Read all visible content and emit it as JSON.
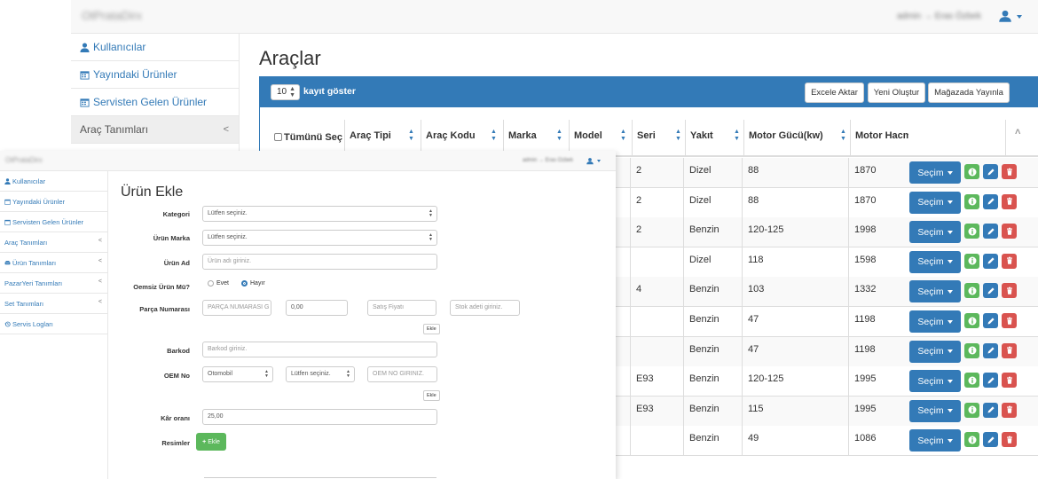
{
  "back": {
    "brand": "OtPrataDirx",
    "user_text": "admin → Eras Özbek",
    "sidebar": [
      {
        "label": "Kullanıcılar",
        "icon": "user-icon",
        "active": false
      },
      {
        "label": "Yayındaki Ürünler",
        "icon": "calendar-icon",
        "active": false
      },
      {
        "label": "Servisten Gelen Ürünler",
        "icon": "calendar-icon",
        "active": false
      },
      {
        "label": "Araç Tanımları",
        "icon": "",
        "active": true,
        "chevron": "<"
      }
    ],
    "page_title": "Araçlar",
    "length_value": "10",
    "length_label": "kayıt göster",
    "buttons": {
      "excel": "Excele Aktar",
      "new": "Yeni Oluştur",
      "publish": "Mağazada Yayınla"
    },
    "columns": [
      "Tümünü Seç",
      "Araç Tipi",
      "Araç Kodu",
      "Marka",
      "Model",
      "Seri",
      "Yakıt",
      "Motor Gücü(kw)",
      "Motor Hacm"
    ],
    "rows": [
      {
        "seri": "2",
        "yakit": "Dizel",
        "guc": "88",
        "hacim": "1870"
      },
      {
        "seri": "2",
        "yakit": "Dizel",
        "guc": "88",
        "hacim": "1870"
      },
      {
        "seri": "2",
        "yakit": "Benzin",
        "guc": "120-125",
        "hacim": "1998"
      },
      {
        "seri": "",
        "yakit": "Dizel",
        "guc": "118",
        "hacim": "1598"
      },
      {
        "seri": "4",
        "yakit": "Benzin",
        "guc": "103",
        "hacim": "1332"
      },
      {
        "seri": "",
        "yakit": "Benzin",
        "guc": "47",
        "hacim": "1198"
      },
      {
        "seri": "",
        "yakit": "Benzin",
        "guc": "47",
        "hacim": "1198"
      },
      {
        "seri": "E93",
        "yakit": "Benzin",
        "guc": "120-125",
        "hacim": "1995"
      },
      {
        "seri": "E93",
        "yakit": "Benzin",
        "guc": "115",
        "hacim": "1995"
      },
      {
        "seri": "",
        "yakit": "Benzin",
        "guc": "49",
        "hacim": "1086"
      }
    ],
    "secim_label": "Seçim"
  },
  "front": {
    "brand": "OtPrataDirx",
    "user_text": "admin → Eras Özbek",
    "sidebar": [
      {
        "label": "Kullanıcılar",
        "icon": "user-icon"
      },
      {
        "label": "Yayındaki Ürünler",
        "icon": "calendar-icon"
      },
      {
        "label": "Servisten Gelen Ürünler",
        "icon": "calendar-icon"
      },
      {
        "label": "Araç Tanımları",
        "icon": "",
        "chevron": "<"
      },
      {
        "label": "Ürün Tanımları",
        "icon": "car-icon",
        "chevron": "<"
      },
      {
        "label": "PazarYeri Tanımları",
        "icon": "",
        "chevron": "<"
      },
      {
        "label": "Set Tanımları",
        "icon": "",
        "chevron": "<"
      },
      {
        "label": "Servis Logları",
        "icon": "history-icon"
      }
    ],
    "title": "Ürün Ekle",
    "form": {
      "kategori_label": "Kategori",
      "kategori_value": "Lütfen seçiniz.",
      "marka_label": "Ürün Marka",
      "marka_value": "Lütfen seçiniz.",
      "ad_label": "Ürün Ad",
      "ad_placeholder": "Ürün adı giriniz.",
      "oem_q_label": "Oemsiz Ürün Mü?",
      "radio_yes": "Evet",
      "radio_no": "Hayır",
      "parca_label": "Parça Numarası",
      "parca_placeholder": "PARÇA NUMARASI G",
      "parca_price": "0,00",
      "satis_placeholder": "Satış Fiyatı",
      "stok_placeholder": "Stok adeti giriniz.",
      "ekle_small": "Ekle",
      "barkod_label": "Barkod",
      "barkod_placeholder": "Barkod giriniz.",
      "oem_label": "OEM No",
      "oem_type": "Otomobil",
      "oem_select": "Lütfen seçiniz.",
      "oem_placeholder": "OEM NO GIRINIZ.",
      "kar_label": "Kâr oranı",
      "kar_value": "25,00",
      "resim_label": "Resimler",
      "resim_btn": "Ekle"
    }
  }
}
